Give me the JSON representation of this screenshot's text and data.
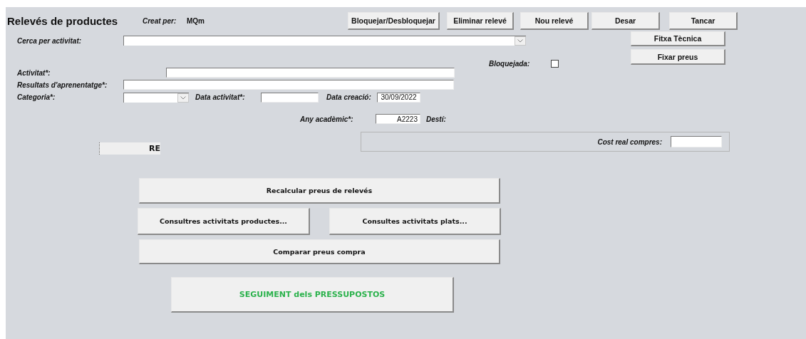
{
  "title": "Relevés de productes",
  "creator": {
    "label": "Creat per:",
    "value": "MQm"
  },
  "toolbar": [
    "Bloquejar/Desbloquejar",
    "Eliminar relevé",
    "Nou relevé",
    "Desar",
    "Tancar"
  ],
  "search": {
    "label": "Cerca  per  activitat:"
  },
  "side_buttons": [
    "Fitxa Tècnica",
    "Fixar preus"
  ],
  "locked": {
    "label": "Bloquejada:",
    "checked": false
  },
  "activity": {
    "label": "Activitat*:"
  },
  "outcomes": {
    "label": "Resultats d'aprenentatge*:"
  },
  "category": {
    "label": "Categoria*:"
  },
  "activity_date": {
    "label": "Data activitat*:"
  },
  "creation_date": {
    "label": "Data creació:",
    "value": "30/09/2022"
  },
  "academic_year": {
    "label": "Any acadèmic*:",
    "value": "A2223"
  },
  "destination": {
    "label": "Destí:"
  },
  "re_label": "RE",
  "cost": {
    "label": "Cost real compres:"
  },
  "actions": [
    "Recalcular preus de relevés",
    "Consultres activitats productes...",
    "Consultes activitats plats...",
    "Comparar preus compra"
  ],
  "tracking_button": "SEGUIMENT dels PRESSUPOSTOS"
}
